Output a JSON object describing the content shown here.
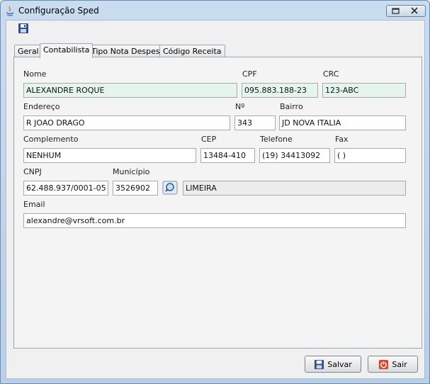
{
  "window": {
    "title": "Configuração Sped"
  },
  "tabs": [
    {
      "label": "Geral"
    },
    {
      "label": "Contabilista",
      "active": true
    },
    {
      "label": "Tipo Nota Despesa"
    },
    {
      "label": "Código Receita"
    }
  ],
  "form": {
    "nome": {
      "label": "Nome",
      "value": "ALEXANDRE ROQUE"
    },
    "cpf": {
      "label": "CPF",
      "value": "095.883.188-23"
    },
    "crc": {
      "label": "CRC",
      "value": "123-ABC"
    },
    "endereco": {
      "label": "Endereço",
      "value": "R JOAO DRAGO"
    },
    "numero": {
      "label": "Nº",
      "value": "343"
    },
    "bairro": {
      "label": "Bairro",
      "value": "JD NOVA ITALIA"
    },
    "complemento": {
      "label": "Complemento",
      "value": "NENHUM"
    },
    "cep": {
      "label": "CEP",
      "value": "13484-410"
    },
    "telefone": {
      "label": "Telefone",
      "value": "(19) 34413092"
    },
    "fax": {
      "label": "Fax",
      "value": "(  )"
    },
    "cnpj": {
      "label": "CNPJ",
      "value": "62.488.937/0001-05"
    },
    "municipio": {
      "label": "Município",
      "code": "3526902",
      "name": "LIMEIRA"
    },
    "email": {
      "label": "Email",
      "value": "alexandre@vrsoft.com.br"
    }
  },
  "buttons": {
    "salvar": "Salvar",
    "sair": "Sair"
  },
  "icons": {
    "toolbar_save": "floppy-disk-icon",
    "lookup": "magnifier-icon",
    "sair": "power-icon"
  }
}
